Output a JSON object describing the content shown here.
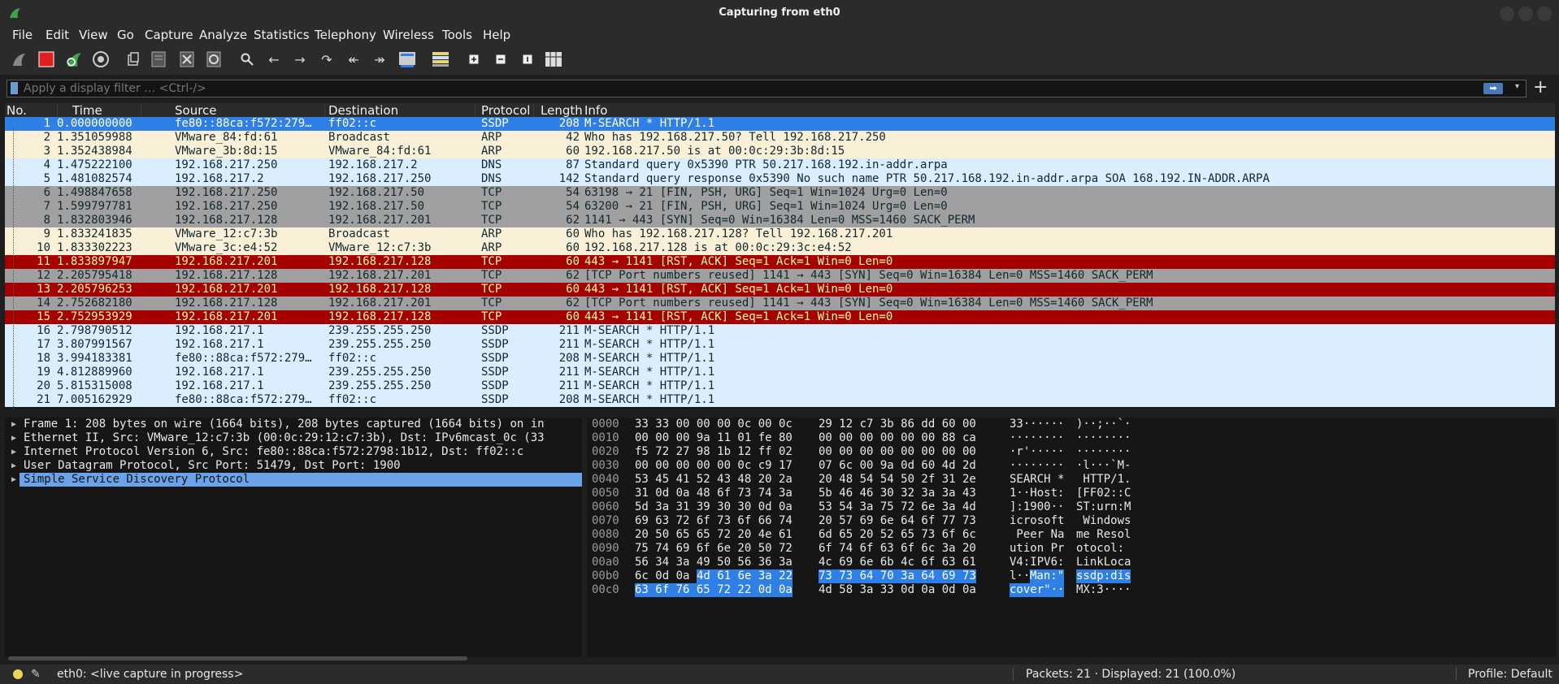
{
  "window": {
    "title": "Capturing from eth0"
  },
  "menu": [
    "File",
    "Edit",
    "View",
    "Go",
    "Capture",
    "Analyze",
    "Statistics",
    "Telephony",
    "Wireless",
    "Tools",
    "Help"
  ],
  "filter": {
    "placeholder": "Apply a display filter … <Ctrl-/>"
  },
  "columns": [
    "No.",
    "Time",
    "Source",
    "Destination",
    "Protocol",
    "Length",
    "Info"
  ],
  "packets": [
    {
      "no": "1",
      "time": "0.000000000",
      "src": "fe80::88ca:f572:279…",
      "dst": "ff02::c",
      "proto": "SSDP",
      "len": "208",
      "info": "M-SEARCH * HTTP/1.1",
      "style": "sel"
    },
    {
      "no": "2",
      "time": "1.351059988",
      "src": "VMware_84:fd:61",
      "dst": "Broadcast",
      "proto": "ARP",
      "len": "42",
      "info": "Who has 192.168.217.50? Tell 192.168.217.250",
      "style": "arp"
    },
    {
      "no": "3",
      "time": "1.352438984",
      "src": "VMware_3b:8d:15",
      "dst": "VMware_84:fd:61",
      "proto": "ARP",
      "len": "60",
      "info": "192.168.217.50 is at 00:0c:29:3b:8d:15",
      "style": "arp"
    },
    {
      "no": "4",
      "time": "1.475222100",
      "src": "192.168.217.250",
      "dst": "192.168.217.2",
      "proto": "DNS",
      "len": "87",
      "info": "Standard query 0x5390 PTR 50.217.168.192.in-addr.arpa",
      "style": "dns"
    },
    {
      "no": "5",
      "time": "1.481082574",
      "src": "192.168.217.2",
      "dst": "192.168.217.250",
      "proto": "DNS",
      "len": "142",
      "info": "Standard query response 0x5390 No such name PTR 50.217.168.192.in-addr.arpa SOA 168.192.IN-ADDR.ARPA",
      "style": "dns"
    },
    {
      "no": "6",
      "time": "1.498847658",
      "src": "192.168.217.250",
      "dst": "192.168.217.50",
      "proto": "TCP",
      "len": "54",
      "info": "63198 → 21 [FIN, PSH, URG] Seq=1 Win=1024 Urg=0 Len=0",
      "style": "tcpgray"
    },
    {
      "no": "7",
      "time": "1.599797781",
      "src": "192.168.217.250",
      "dst": "192.168.217.50",
      "proto": "TCP",
      "len": "54",
      "info": "63200 → 21 [FIN, PSH, URG] Seq=1 Win=1024 Urg=0 Len=0",
      "style": "tcpgray"
    },
    {
      "no": "8",
      "time": "1.832803946",
      "src": "192.168.217.128",
      "dst": "192.168.217.201",
      "proto": "TCP",
      "len": "62",
      "info": "1141 → 443 [SYN] Seq=0 Win=16384 Len=0 MSS=1460 SACK_PERM",
      "style": "tcpgray"
    },
    {
      "no": "9",
      "time": "1.833241835",
      "src": "VMware_12:c7:3b",
      "dst": "Broadcast",
      "proto": "ARP",
      "len": "60",
      "info": "Who has 192.168.217.128? Tell 192.168.217.201",
      "style": "arp"
    },
    {
      "no": "10",
      "time": "1.833302223",
      "src": "VMware_3c:e4:52",
      "dst": "VMware_12:c7:3b",
      "proto": "ARP",
      "len": "60",
      "info": "192.168.217.128 is at 00:0c:29:3c:e4:52",
      "style": "arp"
    },
    {
      "no": "11",
      "time": "1.833897947",
      "src": "192.168.217.201",
      "dst": "192.168.217.128",
      "proto": "TCP",
      "len": "60",
      "info": "443 → 1141 [RST, ACK] Seq=1 Ack=1 Win=0 Len=0",
      "style": "rst"
    },
    {
      "no": "12",
      "time": "2.205795418",
      "src": "192.168.217.128",
      "dst": "192.168.217.201",
      "proto": "TCP",
      "len": "62",
      "info": "[TCP Port numbers reused] 1141 → 443 [SYN] Seq=0 Win=16384 Len=0 MSS=1460 SACK_PERM",
      "style": "reuse"
    },
    {
      "no": "13",
      "time": "2.205796253",
      "src": "192.168.217.201",
      "dst": "192.168.217.128",
      "proto": "TCP",
      "len": "60",
      "info": "443 → 1141 [RST, ACK] Seq=1 Ack=1 Win=0 Len=0",
      "style": "rst"
    },
    {
      "no": "14",
      "time": "2.752682180",
      "src": "192.168.217.128",
      "dst": "192.168.217.201",
      "proto": "TCP",
      "len": "62",
      "info": "[TCP Port numbers reused] 1141 → 443 [SYN] Seq=0 Win=16384 Len=0 MSS=1460 SACK_PERM",
      "style": "reuse"
    },
    {
      "no": "15",
      "time": "2.752953929",
      "src": "192.168.217.201",
      "dst": "192.168.217.128",
      "proto": "TCP",
      "len": "60",
      "info": "443 → 1141 [RST, ACK] Seq=1 Ack=1 Win=0 Len=0",
      "style": "rst"
    },
    {
      "no": "16",
      "time": "2.798790512",
      "src": "192.168.217.1",
      "dst": "239.255.255.250",
      "proto": "SSDP",
      "len": "211",
      "info": "M-SEARCH * HTTP/1.1",
      "style": "ssdp"
    },
    {
      "no": "17",
      "time": "3.807991567",
      "src": "192.168.217.1",
      "dst": "239.255.255.250",
      "proto": "SSDP",
      "len": "211",
      "info": "M-SEARCH * HTTP/1.1",
      "style": "ssdp"
    },
    {
      "no": "18",
      "time": "3.994183381",
      "src": "fe80::88ca:f572:279…",
      "dst": "ff02::c",
      "proto": "SSDP",
      "len": "208",
      "info": "M-SEARCH * HTTP/1.1",
      "style": "ssdp"
    },
    {
      "no": "19",
      "time": "4.812889960",
      "src": "192.168.217.1",
      "dst": "239.255.255.250",
      "proto": "SSDP",
      "len": "211",
      "info": "M-SEARCH * HTTP/1.1",
      "style": "ssdp"
    },
    {
      "no": "20",
      "time": "5.815315008",
      "src": "192.168.217.1",
      "dst": "239.255.255.250",
      "proto": "SSDP",
      "len": "211",
      "info": "M-SEARCH * HTTP/1.1",
      "style": "ssdp"
    },
    {
      "no": "21",
      "time": "7.005162929",
      "src": "fe80::88ca:f572:279…",
      "dst": "ff02::c",
      "proto": "SSDP",
      "len": "208",
      "info": "M-SEARCH * HTTP/1.1",
      "style": "ssdp"
    }
  ],
  "details": [
    "Frame 1: 208 bytes on wire (1664 bits), 208 bytes captured (1664 bits) on in",
    "Ethernet II, Src: VMware_12:c7:3b (00:0c:29:12:c7:3b), Dst: IPv6mcast_0c (33",
    "Internet Protocol Version 6, Src: fe80::88ca:f572:2798:1b12, Dst: ff02::c",
    "User Datagram Protocol, Src Port: 51479, Dst Port: 1900",
    "Simple Service Discovery Protocol"
  ],
  "bytes": [
    {
      "off": "0000",
      "h1": "33 33 00 00 00 0c 00 0c",
      "h2": "29 12 c7 3b 86 dd 60 00",
      "a1": "33······",
      "a2": ")··;··`·"
    },
    {
      "off": "0010",
      "h1": "00 00 00 9a 11 01 fe 80",
      "h2": "00 00 00 00 00 00 88 ca",
      "a1": "········",
      "a2": "········"
    },
    {
      "off": "0020",
      "h1": "f5 72 27 98 1b 12 ff 02",
      "h2": "00 00 00 00 00 00 00 00",
      "a1": "·r'·····",
      "a2": "········"
    },
    {
      "off": "0030",
      "h1": "00 00 00 00 00 0c c9 17",
      "h2": "07 6c 00 9a 0d 60 4d 2d",
      "a1": "········",
      "a2": "·l···`M-"
    },
    {
      "off": "0040",
      "h1": "53 45 41 52 43 48 20 2a",
      "h2": "20 48 54 54 50 2f 31 2e",
      "a1": "SEARCH *",
      "a2": " HTTP/1."
    },
    {
      "off": "0050",
      "h1": "31 0d 0a 48 6f 73 74 3a",
      "h2": "5b 46 46 30 32 3a 3a 43",
      "a1": "1··Host:",
      "a2": "[FF02::C"
    },
    {
      "off": "0060",
      "h1": "5d 3a 31 39 30 30 0d 0a",
      "h2": "53 54 3a 75 72 6e 3a 4d",
      "a1": "]:1900··",
      "a2": "ST:urn:M"
    },
    {
      "off": "0070",
      "h1": "69 63 72 6f 73 6f 66 74",
      "h2": "20 57 69 6e 64 6f 77 73",
      "a1": "icrosoft",
      "a2": " Windows"
    },
    {
      "off": "0080",
      "h1": "20 50 65 65 72 20 4e 61",
      "h2": "6d 65 20 52 65 73 6f 6c",
      "a1": " Peer Na",
      "a2": "me Resol"
    },
    {
      "off": "0090",
      "h1": "75 74 69 6f 6e 20 50 72",
      "h2": "6f 74 6f 63 6f 6c 3a 20",
      "a1": "ution Pr",
      "a2": "otocol: "
    },
    {
      "off": "00a0",
      "h1": "56 34 3a 49 50 56 36 3a",
      "h2": "4c 69 6e 6b 4c 6f 63 61",
      "a1": "V4:IPV6:",
      "a2": "LinkLoca"
    },
    {
      "off": "00b0",
      "h1": "6c 0d 0a ",
      "h1hl": "4d 61 6e 3a 22",
      "h2": "73 73 64 70 3a 64 69 73",
      "h2full": true,
      "a1": "l··",
      "a1hl": "Man:\"",
      "a2": "ssdp:dis",
      "a2full": true
    },
    {
      "off": "00c0",
      "h1": "",
      "h1hl": "63 6f 76 65 72 22 0d 0a",
      "h2": "4d 58 3a 33 0d 0a 0d 0a",
      "a1": "",
      "a1hl": "cover\"··",
      "a2": "MX:3····"
    }
  ],
  "status": {
    "iface": "eth0: <live capture in progress>",
    "counts": "Packets: 21 · Displayed: 21 (100.0%)",
    "profile": "Profile: Default"
  },
  "colors": {
    "selected": "#2e7fe6",
    "rst": "#a40000",
    "arp": "#faf0d7",
    "udp": "#daeeff",
    "tcp": "#a0a0a0"
  }
}
